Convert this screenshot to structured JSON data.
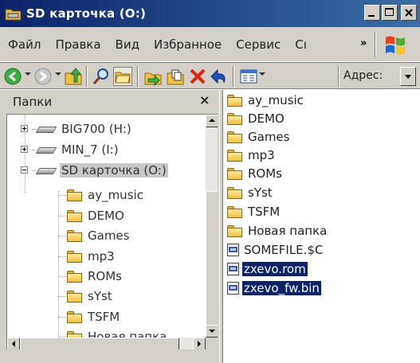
{
  "window": {
    "title": "SD карточка (O:)",
    "accent": "#0a246a"
  },
  "menu": {
    "items": [
      {
        "label": "Файл"
      },
      {
        "label": "Правка"
      },
      {
        "label": "Вид"
      },
      {
        "label": "Избранное"
      },
      {
        "label": "Сервис"
      },
      {
        "label": "Сı"
      }
    ],
    "overflow": "»"
  },
  "toolbar": {
    "address_label": "Адрес:"
  },
  "folders": {
    "title": "Папки",
    "close_glyph": "×",
    "drives": [
      {
        "label": "BIG700 (H:)",
        "expander": "plus"
      },
      {
        "label": "MIN_7 (I:)",
        "expander": "plus"
      },
      {
        "label": "SD карточка (O:)",
        "expander": "minus",
        "selected": true
      }
    ],
    "subfolders": [
      {
        "label": "ay_music"
      },
      {
        "label": "DEMO"
      },
      {
        "label": "Games"
      },
      {
        "label": "mp3"
      },
      {
        "label": "ROMs"
      },
      {
        "label": "sYst"
      },
      {
        "label": "TSFM"
      },
      {
        "label": "Новая папка"
      }
    ]
  },
  "files": {
    "items": [
      {
        "label": "ay_music",
        "icon": "folder-icon"
      },
      {
        "label": "DEMO",
        "icon": "folder-icon"
      },
      {
        "label": "Games",
        "icon": "folder-icon"
      },
      {
        "label": "mp3",
        "icon": "folder-icon"
      },
      {
        "label": "ROMs",
        "icon": "folder-icon"
      },
      {
        "label": "sYst",
        "icon": "folder-icon"
      },
      {
        "label": "TSFM",
        "icon": "folder-icon"
      },
      {
        "label": "Новая папка",
        "icon": "folder-icon"
      },
      {
        "label": "SOMEFILE.$C",
        "icon": "file-icon"
      },
      {
        "label": "zxevo.rom",
        "icon": "file-icon",
        "selected": true
      },
      {
        "label": "zxevo_fw.bin",
        "icon": "file-icon",
        "selected": true
      }
    ]
  }
}
